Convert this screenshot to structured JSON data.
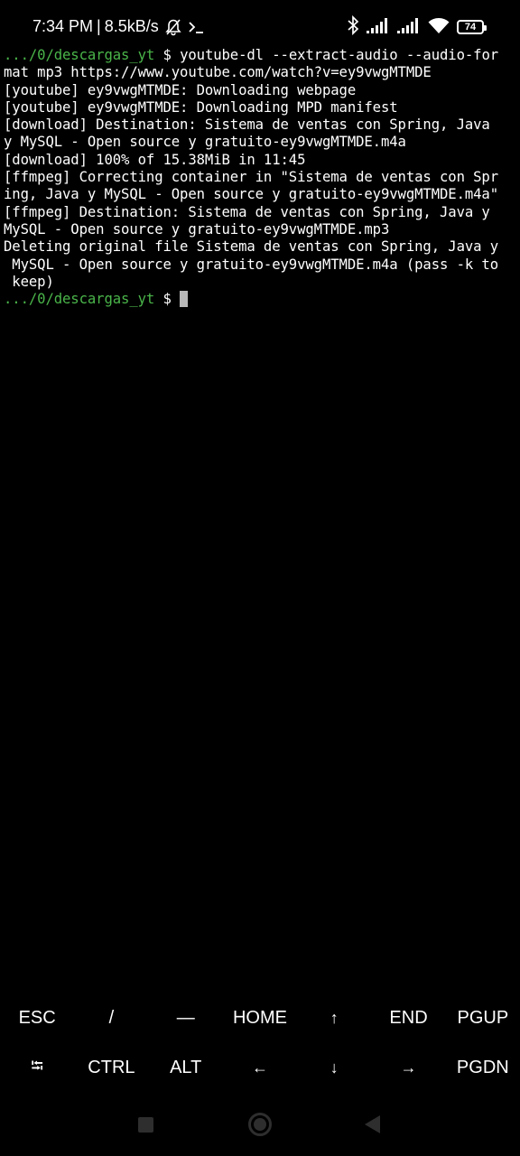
{
  "status_bar": {
    "time": "7:34 PM",
    "separator": "|",
    "network_speed": "8.5kB/s",
    "battery_level": "74",
    "icons": [
      "muted-bell-icon",
      "terminal-prompt-icon",
      "bluetooth-icon",
      "signal-icon",
      "signal-icon",
      "wifi-icon",
      "battery-icon"
    ]
  },
  "terminal": {
    "prompt_path": ".../0/descargas_yt",
    "prompt_symbol": " $ ",
    "command_line_1": "youtube-dl --extract-audio --audio-for",
    "lines": [
      "mat mp3 https://www.youtube.com/watch?v=ey9vwgMTMDE",
      "[youtube] ey9vwgMTMDE: Downloading webpage",
      "[youtube] ey9vwgMTMDE: Downloading MPD manifest",
      "[download] Destination: Sistema de ventas con Spring, Java",
      "y MySQL - Open source y gratuito-ey9vwgMTMDE.m4a",
      "[download] 100% of 15.38MiB in 11:45",
      "[ffmpeg] Correcting container in \"Sistema de ventas con Spr",
      "ing, Java y MySQL - Open source y gratuito-ey9vwgMTMDE.m4a\"",
      "[ffmpeg] Destination: Sistema de ventas con Spring, Java y",
      "MySQL - Open source y gratuito-ey9vwgMTMDE.mp3",
      "Deleting original file Sistema de ventas con Spring, Java y",
      " MySQL - Open source y gratuito-ey9vwgMTMDE.m4a (pass -k to",
      " keep)"
    ]
  },
  "extra_keys": {
    "row1": [
      {
        "label": "ESC",
        "name": "key-esc"
      },
      {
        "label": "/",
        "name": "key-slash"
      },
      {
        "label": "—",
        "name": "key-dash"
      },
      {
        "label": "HOME",
        "name": "key-home"
      },
      {
        "label": "↑",
        "name": "key-up"
      },
      {
        "label": "END",
        "name": "key-end"
      },
      {
        "label": "PGUP",
        "name": "key-pgup"
      }
    ],
    "row2": [
      {
        "label": "⭾",
        "name": "key-tab"
      },
      {
        "label": "CTRL",
        "name": "key-ctrl"
      },
      {
        "label": "ALT",
        "name": "key-alt"
      },
      {
        "label": "←",
        "name": "key-left"
      },
      {
        "label": "↓",
        "name": "key-down"
      },
      {
        "label": "→",
        "name": "key-right"
      },
      {
        "label": "PGDN",
        "name": "key-pgdn"
      }
    ]
  },
  "colors": {
    "prompt_path": "#4ab54a",
    "background": "#000000",
    "text": "#ffffff",
    "cursor": "#b8b8b8"
  }
}
